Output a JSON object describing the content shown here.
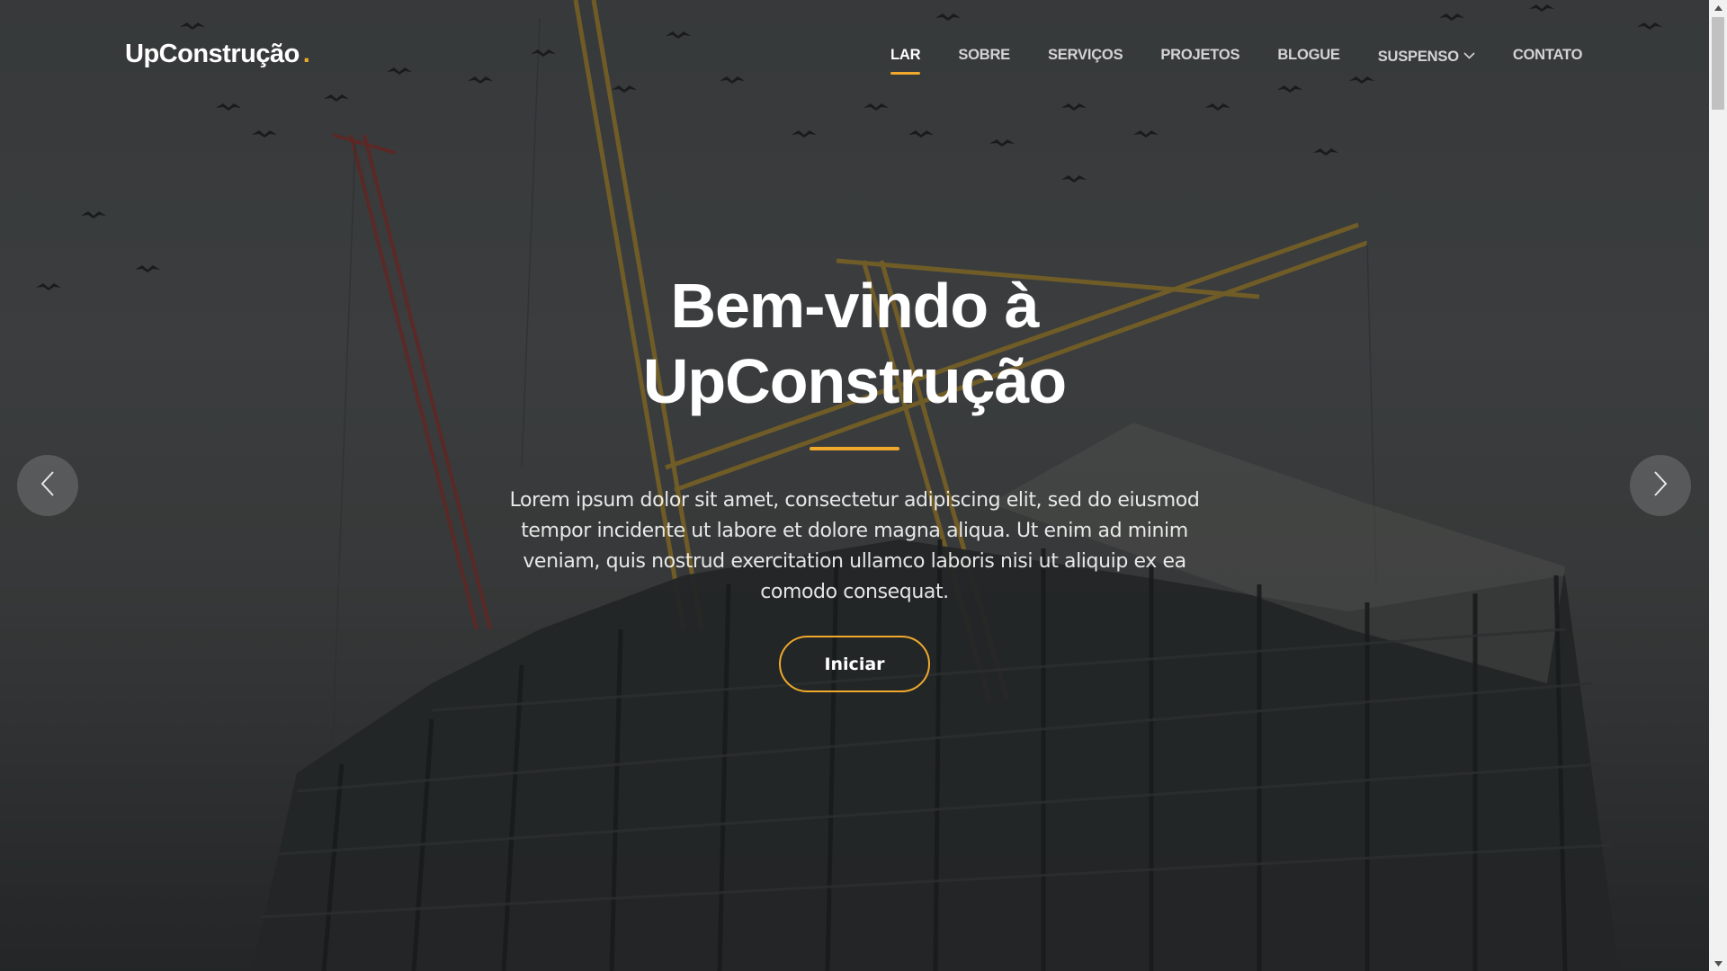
{
  "brand": {
    "name": "UpConstrução",
    "dot": ".",
    "accent": "#f0a92b"
  },
  "nav": {
    "items": [
      {
        "label": "LAR",
        "active": true
      },
      {
        "label": "SOBRE"
      },
      {
        "label": "SERVIÇOS"
      },
      {
        "label": "PROJETOS"
      },
      {
        "label": "BLOGUE"
      },
      {
        "label": "SUSPENSO",
        "dropdown": true
      },
      {
        "label": "CONTATO"
      }
    ]
  },
  "hero": {
    "title_line1": "Bem-vindo à",
    "title_line2": "UpConstrução",
    "text": "Lorem ipsum dolor sit amet, consectetur adipiscing elit, sed do eiusmod tempor incidente ut labore et dolore magna aliqua. Ut enim ad minim veniam, quis nostrud exercitation ullamco laboris nisi ut aliquip ex ea comodo consequat.",
    "cta_label": "Iniciar",
    "background": "construction-site-cranes-birds"
  },
  "carousel": {
    "prev_icon": "chevron-left-icon",
    "next_icon": "chevron-right-icon"
  }
}
